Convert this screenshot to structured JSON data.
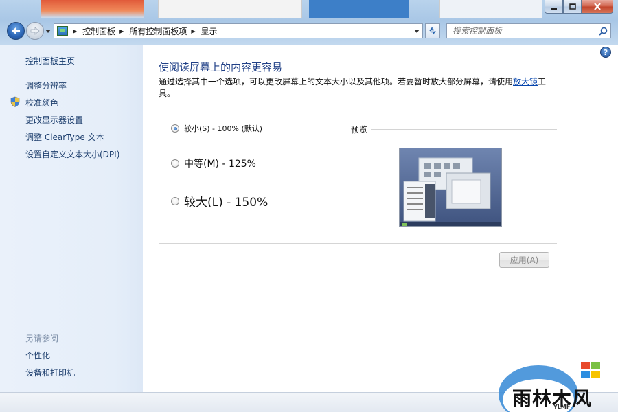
{
  "window": {
    "caption_buttons": [
      "minimize",
      "maximize",
      "close"
    ]
  },
  "toolbar": {
    "breadcrumbs": [
      "控制面板",
      "所有控制面板项",
      "显示"
    ],
    "search_placeholder": "搜索控制面板"
  },
  "sidebar": {
    "home": "控制面板主页",
    "links": [
      "调整分辨率",
      "校准颜色",
      "更改显示器设置",
      "调整 ClearType 文本",
      "设置自定义文本大小(DPI)"
    ],
    "see_also_title": "另请参阅",
    "see_also_links": [
      "个性化",
      "设备和打印机"
    ]
  },
  "main": {
    "heading": "使阅读屏幕上的内容更容易",
    "description_prefix": "通过选择其中一个选项，可以更改屏幕上的文本大小以及其他项。若要暂时放大部分屏幕，请使用",
    "description_link": "放大镜",
    "description_suffix": "工具。",
    "options": [
      {
        "label": "较小(S) - 100% (默认)",
        "checked": true
      },
      {
        "label": "中等(M) - 125%",
        "checked": false
      },
      {
        "label": "较大(L) - 150%",
        "checked": false
      }
    ],
    "preview_label": "预览",
    "apply_button": "应用(A)",
    "help_glyph": "?"
  },
  "watermark": {
    "text": "雨林木风",
    "subtext": "YLMF"
  },
  "colors": {
    "heading": "#1f3f86",
    "link": "#1e3f6e",
    "sidebar_bg": "#e5eef9",
    "glass": "#b9d3ec"
  }
}
